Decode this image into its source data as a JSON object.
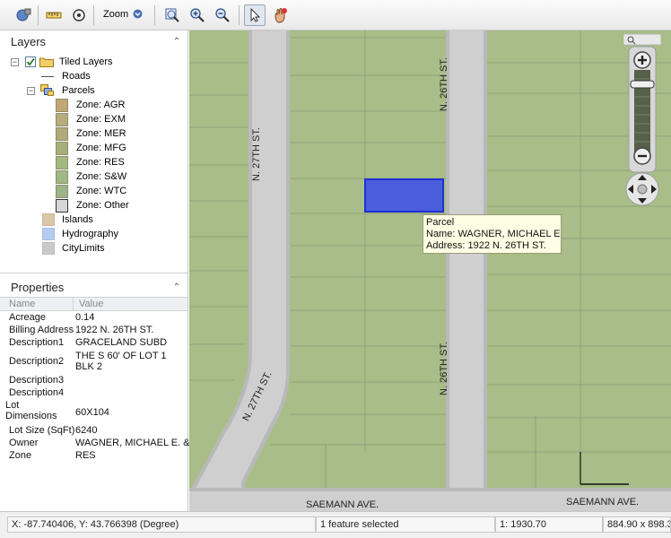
{
  "toolbar": {
    "zoom_label": "Zoom"
  },
  "layers_panel": {
    "title": "Layers",
    "tree": {
      "tiled_layers": "Tiled Layers",
      "roads": "Roads",
      "parcels": "Parcels",
      "zones": [
        {
          "label": "Zone: AGR",
          "color": "#c2a675"
        },
        {
          "label": "Zone: EXM",
          "color": "#b8ab7e"
        },
        {
          "label": "Zone: MER",
          "color": "#b3aa7a"
        },
        {
          "label": "Zone: MFG",
          "color": "#a8ae7a"
        },
        {
          "label": "Zone: RES",
          "color": "#a4b97e"
        },
        {
          "label": "Zone: S&W",
          "color": "#9eb983"
        },
        {
          "label": "Zone: WTC",
          "color": "#9bb389"
        },
        {
          "label": "Zone: Other",
          "color": "#d6d6d6"
        }
      ],
      "islands": {
        "label": "Islands",
        "color": "#d9c8a9"
      },
      "hydrography": {
        "label": "Hydrography",
        "color": "#b5cdef"
      },
      "citylimits": {
        "label": "CityLimits",
        "color": "#c9c9c9"
      }
    }
  },
  "properties_panel": {
    "title": "Properties",
    "col_name": "Name",
    "col_value": "Value",
    "rows": [
      {
        "name": "Acreage",
        "value": "0.14"
      },
      {
        "name": "Billing Address",
        "value": "1922 N. 26TH ST."
      },
      {
        "name": "Description1",
        "value": "GRACELAND SUBD"
      },
      {
        "name": "Description2",
        "value": "THE S 60' OF LOT 1 BLK 2"
      },
      {
        "name": "Description3",
        "value": ""
      },
      {
        "name": "Description4",
        "value": ""
      },
      {
        "name": "Lot Dimensions",
        "value": "60X104"
      },
      {
        "name": "Lot Size (SqFt)",
        "value": "6240"
      },
      {
        "name": "Owner",
        "value": "WAGNER, MICHAEL E. &"
      },
      {
        "name": "Zone",
        "value": "RES"
      }
    ]
  },
  "map": {
    "street_labels": {
      "n26_top": "N. 26TH ST.",
      "n26_bottom": "N. 26TH ST.",
      "n27_top": "N. 27TH ST.",
      "n27_bottom": "N. 27TH ST.",
      "saemann_left": "SAEMANN AVE.",
      "saemann_right": "SAEMANN AVE."
    },
    "tooltip": {
      "title": "Parcel",
      "name_line": "Name: WAGNER, MICHAEL E. &",
      "address_line": "Address: 1922 N. 26TH ST."
    },
    "colors": {
      "parcel_fill": "#a8bd88",
      "road": "#cfcfcf",
      "selected": "#2f45e0"
    }
  },
  "status_bar": {
    "coordinates": "X: -87.740406, Y: 43.766398 (Degree)",
    "selection": "1 feature selected",
    "scale": "1: 1930.70",
    "extent": "884.90 x 898.3"
  }
}
